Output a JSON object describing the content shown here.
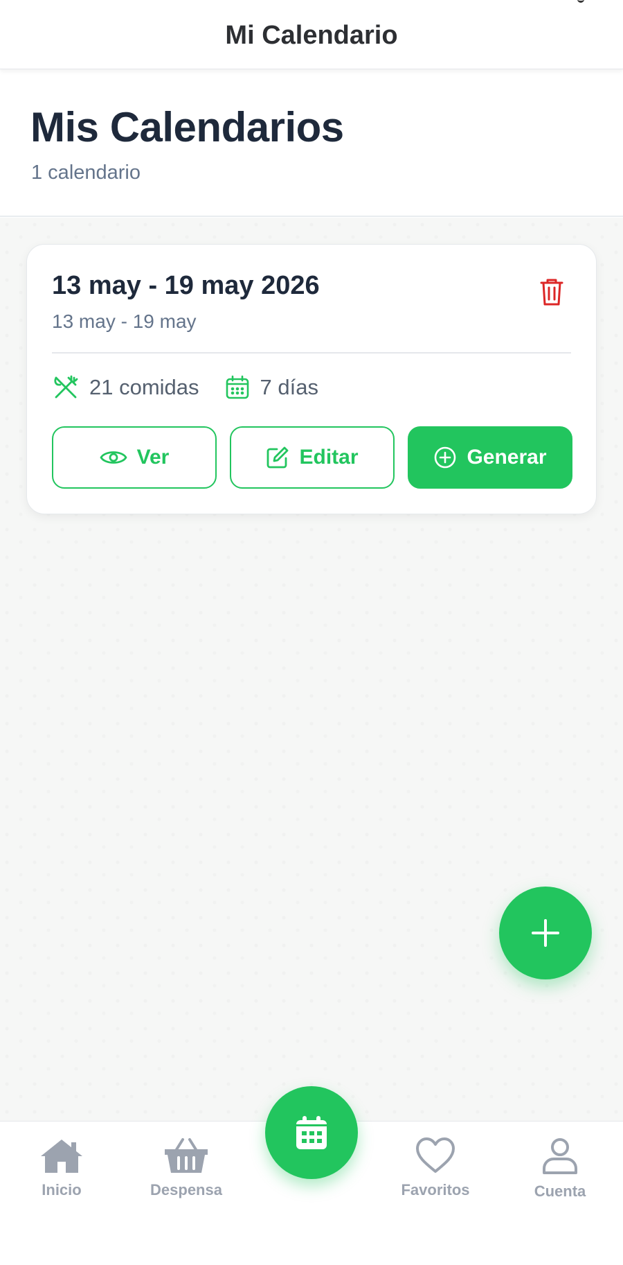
{
  "header": {
    "title": "Mi Calendario"
  },
  "page": {
    "title": "Mis Calendarios",
    "subtitle": "1 calendario"
  },
  "calendar_card": {
    "title": "13 may - 19 may 2026",
    "range": "13 may - 19 may",
    "meals": "21 comidas",
    "days": "7 días",
    "buttons": {
      "view": "Ver",
      "edit": "Editar",
      "generate": "Generar"
    }
  },
  "tabs": [
    {
      "label": "Inicio",
      "icon": "home-icon"
    },
    {
      "label": "Despensa",
      "icon": "basket-icon"
    },
    {
      "label": "",
      "icon": "calendar-icon"
    },
    {
      "label": "Favoritos",
      "icon": "heart-icon"
    },
    {
      "label": "Cuenta",
      "icon": "user-icon"
    }
  ],
  "colors": {
    "accent": "#22c55e",
    "danger": "#dc2626",
    "text_primary": "#1e293b",
    "text_secondary": "#64748b",
    "tab_inactive": "#9ca3af"
  }
}
